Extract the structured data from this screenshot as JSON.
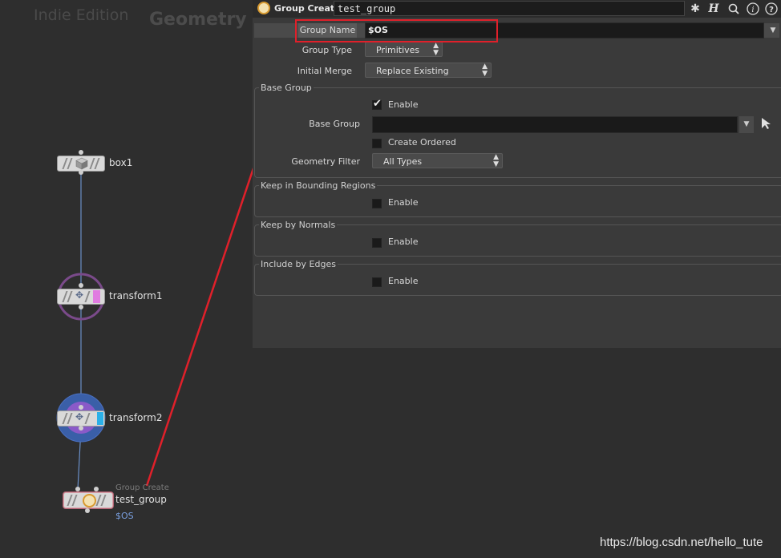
{
  "network": {
    "edition": "Indie Edition",
    "context": "Geometry",
    "nodes": [
      {
        "name": "box1"
      },
      {
        "name": "transform1"
      },
      {
        "name": "transform2"
      },
      {
        "type": "Group Create",
        "name": "test_group",
        "comment": "$OS"
      }
    ]
  },
  "panel": {
    "toolbar": {
      "node_type": "Group Create",
      "node_name": "test_group",
      "gear_icon": "gear-icon",
      "help_icon": "?"
    },
    "group_name": {
      "label": "Group Name",
      "value": "$OS"
    },
    "group_type": {
      "label": "Group Type",
      "value": "Primitives"
    },
    "initial_merge": {
      "label": "Initial Merge",
      "value": "Replace Existing"
    },
    "base_group_section": {
      "title": "Base Group",
      "enable_label": "Enable",
      "enable_checked": true,
      "base_group_label": "Base Group",
      "base_group_value": "",
      "create_ordered_label": "Create Ordered",
      "geometry_filter_label": "Geometry Filter",
      "geometry_filter_value": "All Types"
    },
    "bounding_section": {
      "title": "Keep in Bounding Regions",
      "enable_label": "Enable"
    },
    "normals_section": {
      "title": "Keep by Normals",
      "enable_label": "Enable"
    },
    "edges_section": {
      "title": "Include by Edges",
      "enable_label": "Enable"
    }
  },
  "footer": {
    "url": "https://blog.csdn.net/hello_tute"
  },
  "colors": {
    "annotation": "#e0202a",
    "wire": "#6a8fc8",
    "transform1_flag": "#e07be0",
    "transform2_flag": "#2ab0e8"
  }
}
